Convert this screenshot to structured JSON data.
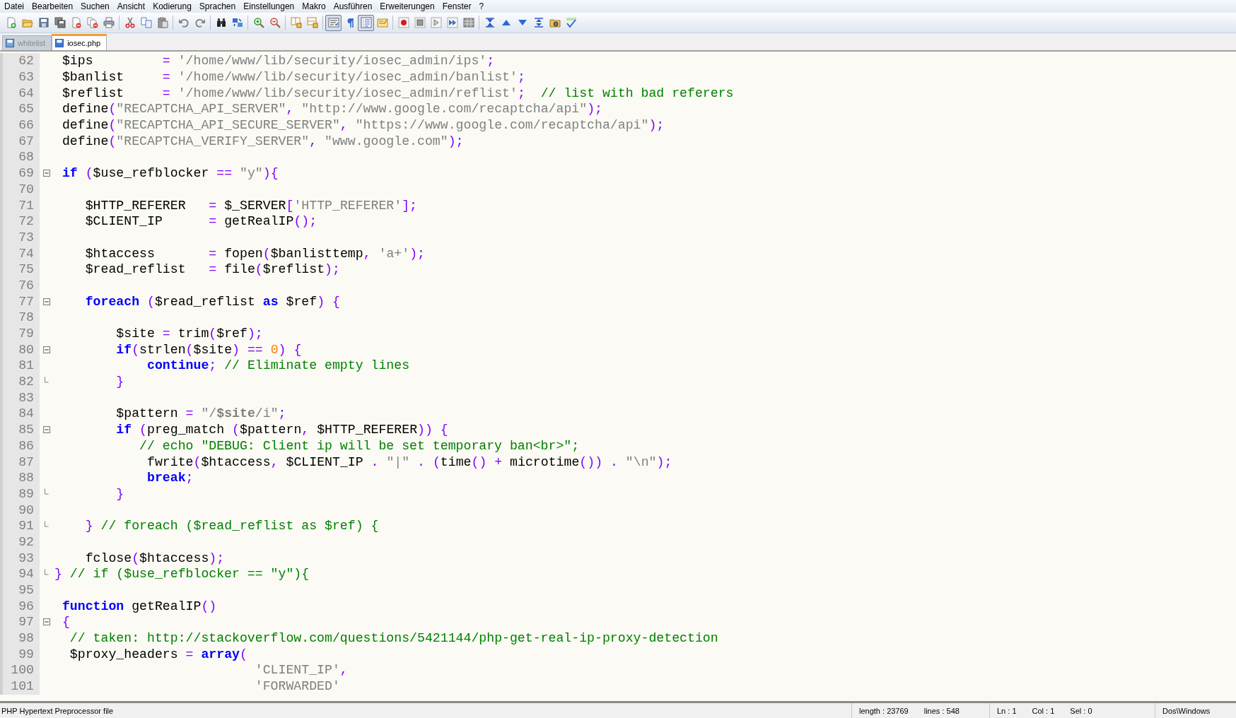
{
  "menu": [
    "Datei",
    "Bearbeiten",
    "Suchen",
    "Ansicht",
    "Kodierung",
    "Sprachen",
    "Einstellungen",
    "Makro",
    "Ausführen",
    "Erweiterungen",
    "Fenster",
    "?"
  ],
  "toolbar": {
    "toggles": [
      {
        "pressed": true
      },
      {
        "pressed": false
      },
      {
        "pressed": true
      }
    ]
  },
  "tabs": [
    {
      "label": "whitelist",
      "selected": false
    },
    {
      "label": "iosec.php",
      "selected": true
    }
  ],
  "editor": {
    "lines": [
      {
        "number": "62",
        "tokens": [
          {
            "kind": "plain",
            "text": " $ips         "
          },
          {
            "kind": "operator",
            "text": "="
          },
          {
            "kind": "string",
            "text": " '/home/www/lib/security/iosec_admin/ips'"
          },
          {
            "kind": "operator",
            "text": ";"
          }
        ]
      },
      {
        "number": "63",
        "tokens": [
          {
            "kind": "plain",
            "text": " $banlist     "
          },
          {
            "kind": "operator",
            "text": "="
          },
          {
            "kind": "string",
            "text": " '/home/www/lib/security/iosec_admin/banlist'"
          },
          {
            "kind": "operator",
            "text": ";"
          }
        ]
      },
      {
        "number": "64",
        "tokens": [
          {
            "kind": "plain",
            "text": " $reflist     "
          },
          {
            "kind": "operator",
            "text": "="
          },
          {
            "kind": "string",
            "text": " '/home/www/lib/security/iosec_admin/reflist'"
          },
          {
            "kind": "operator",
            "text": ";"
          },
          {
            "kind": "comment",
            "text": "  // list with bad referers"
          }
        ]
      },
      {
        "number": "65",
        "tokens": [
          {
            "kind": "plain",
            "text": " define"
          },
          {
            "kind": "operator",
            "text": "("
          },
          {
            "kind": "string",
            "text": "\"RECAPTCHA_API_SERVER\""
          },
          {
            "kind": "operator",
            "text": ","
          },
          {
            "kind": "string",
            "text": " \"http://www.google.com/recaptcha/api\""
          },
          {
            "kind": "operator",
            "text": ");"
          }
        ]
      },
      {
        "number": "66",
        "tokens": [
          {
            "kind": "plain",
            "text": " define"
          },
          {
            "kind": "operator",
            "text": "("
          },
          {
            "kind": "string",
            "text": "\"RECAPTCHA_API_SECURE_SERVER\""
          },
          {
            "kind": "operator",
            "text": ","
          },
          {
            "kind": "string",
            "text": " \"https://www.google.com/recaptcha/api\""
          },
          {
            "kind": "operator",
            "text": ");"
          }
        ]
      },
      {
        "number": "67",
        "tokens": [
          {
            "kind": "plain",
            "text": " define"
          },
          {
            "kind": "operator",
            "text": "("
          },
          {
            "kind": "string",
            "text": "\"RECAPTCHA_VERIFY_SERVER\""
          },
          {
            "kind": "operator",
            "text": ","
          },
          {
            "kind": "string",
            "text": " \"www.google.com\""
          },
          {
            "kind": "operator",
            "text": ");"
          }
        ]
      },
      {
        "number": "68"
      },
      {
        "number": "69",
        "fold_start": true,
        "fold_end": false,
        "tokens": [
          {
            "kind": "keyword",
            "text": " if"
          },
          {
            "kind": "operator",
            "text": " ("
          },
          {
            "kind": "plain",
            "text": "$use_refblocker "
          },
          {
            "kind": "operator",
            "text": "=="
          },
          {
            "kind": "string",
            "text": " \"y\""
          },
          {
            "kind": "operator",
            "text": "){"
          }
        ]
      },
      {
        "number": "70"
      },
      {
        "number": "71",
        "tokens": [
          {
            "kind": "plain",
            "text": "    $HTTP_REFERER   "
          },
          {
            "kind": "operator",
            "text": "="
          },
          {
            "kind": "plain",
            "text": " $_SERVER"
          },
          {
            "kind": "operator",
            "text": "["
          },
          {
            "kind": "string",
            "text": "'HTTP_REFERER'"
          },
          {
            "kind": "operator",
            "text": "];"
          }
        ]
      },
      {
        "number": "72",
        "tokens": [
          {
            "kind": "plain",
            "text": "    $CLIENT_IP      "
          },
          {
            "kind": "operator",
            "text": "="
          },
          {
            "kind": "plain",
            "text": " getRealIP"
          },
          {
            "kind": "operator",
            "text": "();"
          }
        ]
      },
      {
        "number": "73"
      },
      {
        "number": "74",
        "tokens": [
          {
            "kind": "plain",
            "text": "    $htaccess       "
          },
          {
            "kind": "operator",
            "text": "="
          },
          {
            "kind": "plain",
            "text": " fopen"
          },
          {
            "kind": "operator",
            "text": "("
          },
          {
            "kind": "plain",
            "text": "$banlisttemp"
          },
          {
            "kind": "operator",
            "text": ","
          },
          {
            "kind": "string",
            "text": " 'a+'"
          },
          {
            "kind": "operator",
            "text": ");"
          }
        ]
      },
      {
        "number": "75",
        "tokens": [
          {
            "kind": "plain",
            "text": "    $read_reflist   "
          },
          {
            "kind": "operator",
            "text": "="
          },
          {
            "kind": "plain",
            "text": " file"
          },
          {
            "kind": "operator",
            "text": "("
          },
          {
            "kind": "plain",
            "text": "$reflist"
          },
          {
            "kind": "operator",
            "text": ");"
          }
        ]
      },
      {
        "number": "76"
      },
      {
        "number": "77",
        "fold_start": true,
        "fold_end": false,
        "tokens": [
          {
            "kind": "keyword",
            "text": "    foreach"
          },
          {
            "kind": "operator",
            "text": " ("
          },
          {
            "kind": "plain",
            "text": "$read_reflist "
          },
          {
            "kind": "keyword",
            "text": "as"
          },
          {
            "kind": "plain",
            "text": " $ref"
          },
          {
            "kind": "operator",
            "text": ") {"
          }
        ]
      },
      {
        "number": "78"
      },
      {
        "number": "79",
        "tokens": [
          {
            "kind": "plain",
            "text": "        $site "
          },
          {
            "kind": "operator",
            "text": "="
          },
          {
            "kind": "plain",
            "text": " trim"
          },
          {
            "kind": "operator",
            "text": "("
          },
          {
            "kind": "plain",
            "text": "$ref"
          },
          {
            "kind": "operator",
            "text": ");"
          }
        ]
      },
      {
        "number": "80",
        "fold_start": true,
        "fold_end": false,
        "tokens": [
          {
            "kind": "keyword",
            "text": "        if"
          },
          {
            "kind": "operator",
            "text": "("
          },
          {
            "kind": "plain",
            "text": "strlen"
          },
          {
            "kind": "operator",
            "text": "("
          },
          {
            "kind": "plain",
            "text": "$site"
          },
          {
            "kind": "operator",
            "text": ") =="
          },
          {
            "kind": "number",
            "text": " 0"
          },
          {
            "kind": "operator",
            "text": ") {"
          }
        ]
      },
      {
        "number": "81",
        "tokens": [
          {
            "kind": "keyword",
            "text": "            continue"
          },
          {
            "kind": "operator",
            "text": ";"
          },
          {
            "kind": "comment",
            "text": " // Eliminate empty lines"
          }
        ]
      },
      {
        "number": "82",
        "fold_start": false,
        "fold_end": true,
        "tokens": [
          {
            "kind": "operator",
            "text": "        }"
          }
        ]
      },
      {
        "number": "83"
      },
      {
        "number": "84",
        "tokens": [
          {
            "kind": "plain",
            "text": "        $pattern "
          },
          {
            "kind": "operator",
            "text": "="
          },
          {
            "kind": "string",
            "text": " \"/"
          },
          {
            "kind": "strvar",
            "text": "$site"
          },
          {
            "kind": "string",
            "text": "/i\""
          },
          {
            "kind": "operator",
            "text": ";"
          }
        ]
      },
      {
        "number": "85",
        "fold_start": true,
        "fold_end": false,
        "tokens": [
          {
            "kind": "keyword",
            "text": "        if"
          },
          {
            "kind": "operator",
            "text": " ("
          },
          {
            "kind": "plain",
            "text": "preg_match "
          },
          {
            "kind": "operator",
            "text": "("
          },
          {
            "kind": "plain",
            "text": "$pattern"
          },
          {
            "kind": "operator",
            "text": ","
          },
          {
            "kind": "plain",
            "text": " $HTTP_REFERER"
          },
          {
            "kind": "operator",
            "text": ")) {"
          }
        ]
      },
      {
        "number": "86",
        "tokens": [
          {
            "kind": "comment",
            "text": "           // echo \"DEBUG: Client ip will be set temporary ban<br>\";"
          }
        ]
      },
      {
        "number": "87",
        "tokens": [
          {
            "kind": "plain",
            "text": "            fwrite"
          },
          {
            "kind": "operator",
            "text": "("
          },
          {
            "kind": "plain",
            "text": "$htaccess"
          },
          {
            "kind": "operator",
            "text": ","
          },
          {
            "kind": "plain",
            "text": " $CLIENT_IP "
          },
          {
            "kind": "operator",
            "text": "."
          },
          {
            "kind": "string",
            "text": " \"|\""
          },
          {
            "kind": "operator",
            "text": " . ("
          },
          {
            "kind": "plain",
            "text": "time"
          },
          {
            "kind": "operator",
            "text": "() +"
          },
          {
            "kind": "plain",
            "text": " microtime"
          },
          {
            "kind": "operator",
            "text": "()) ."
          },
          {
            "kind": "string",
            "text": " \"\\n\""
          },
          {
            "kind": "operator",
            "text": ");"
          }
        ]
      },
      {
        "number": "88",
        "tokens": [
          {
            "kind": "keyword",
            "text": "            break"
          },
          {
            "kind": "operator",
            "text": ";"
          }
        ]
      },
      {
        "number": "89",
        "fold_start": false,
        "fold_end": true,
        "tokens": [
          {
            "kind": "operator",
            "text": "        }"
          }
        ]
      },
      {
        "number": "90"
      },
      {
        "number": "91",
        "fold_start": false,
        "fold_end": true,
        "tokens": [
          {
            "kind": "operator",
            "text": "    }"
          },
          {
            "kind": "comment",
            "text": " // foreach ($read_reflist as $ref) {"
          }
        ]
      },
      {
        "number": "92"
      },
      {
        "number": "93",
        "tokens": [
          {
            "kind": "plain",
            "text": "    fclose"
          },
          {
            "kind": "operator",
            "text": "("
          },
          {
            "kind": "plain",
            "text": "$htaccess"
          },
          {
            "kind": "operator",
            "text": ");"
          }
        ]
      },
      {
        "number": "94",
        "fold_start": false,
        "fold_end": true,
        "tokens": [
          {
            "kind": "operator",
            "text": "}"
          },
          {
            "kind": "comment",
            "text": " // if ($use_refblocker == \"y\"){"
          }
        ]
      },
      {
        "number": "95"
      },
      {
        "number": "96",
        "tokens": [
          {
            "kind": "keyword",
            "text": " function"
          },
          {
            "kind": "plain",
            "text": " getRealIP"
          },
          {
            "kind": "operator",
            "text": "()"
          }
        ]
      },
      {
        "number": "97",
        "fold_start": true,
        "fold_end": false,
        "tokens": [
          {
            "kind": "operator",
            "text": " {"
          }
        ]
      },
      {
        "number": "98",
        "tokens": [
          {
            "kind": "comment",
            "text": "  // taken: http://stackoverflow.com/questions/5421144/php-get-real-ip-proxy-detection"
          }
        ]
      },
      {
        "number": "99",
        "tokens": [
          {
            "kind": "plain",
            "text": "  $proxy_headers "
          },
          {
            "kind": "operator",
            "text": "="
          },
          {
            "kind": "keyword",
            "text": " array"
          },
          {
            "kind": "operator",
            "text": "("
          }
        ]
      },
      {
        "number": "100",
        "tokens": [
          {
            "kind": "string",
            "text": "                          'CLIENT_IP'"
          },
          {
            "kind": "operator",
            "text": ","
          }
        ]
      },
      {
        "number": "101",
        "tokens": [
          {
            "kind": "string",
            "text": "                          'FORWARDED'"
          }
        ]
      }
    ]
  },
  "status_bar": {
    "file_type": "PHP Hypertext Preprocessor file",
    "length": "length : 23769",
    "lines": "lines : 548",
    "ln": "Ln : 1",
    "col": "Col : 1",
    "sel": "Sel : 0",
    "eol": "Dos\\Windows"
  }
}
